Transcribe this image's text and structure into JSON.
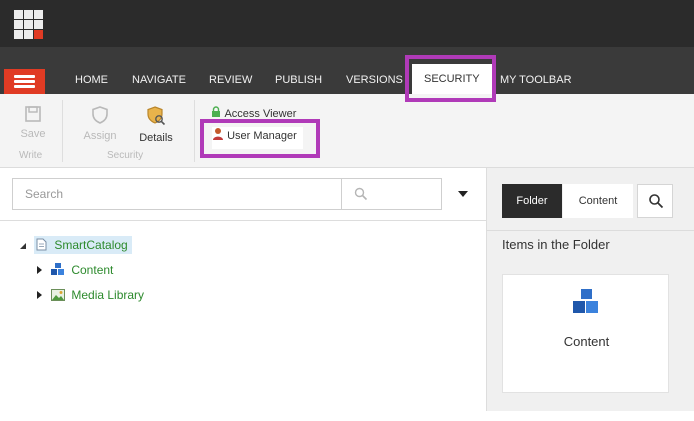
{
  "ribbon": {
    "tabs": [
      "HOME",
      "NAVIGATE",
      "REVIEW",
      "PUBLISH",
      "VERSIONS",
      "SECURITY",
      "MY TOOLBAR"
    ],
    "active_tab": "SECURITY"
  },
  "toolbar": {
    "save_label": "Save",
    "write_group": "Write",
    "assign_label": "Assign",
    "details_label": "Details",
    "security_group": "Security",
    "access_viewer_label": "Access Viewer",
    "user_manager_label": "User Manager"
  },
  "search": {
    "placeholder": "Search"
  },
  "tree": {
    "root": "SmartCatalog",
    "children": [
      "Content",
      "Media Library"
    ]
  },
  "right_panel": {
    "tabs": [
      "Folder",
      "Content"
    ],
    "active_tab": "Folder",
    "heading": "Items in the Folder",
    "items": [
      {
        "label": "Content"
      }
    ]
  },
  "colors": {
    "accent_red": "#e03b24",
    "highlight": "#b03ab8",
    "tree_text": "#2d8a2d"
  },
  "icons": {
    "app": "app-grid-icon",
    "menu": "hamburger-icon",
    "save": "floppy-disk-icon",
    "assign": "shield-icon",
    "details": "shield-details-icon",
    "access_viewer": "lock-icon",
    "user_manager": "user-icon",
    "search": "magnifier-icon",
    "dropdown": "caret-down-icon",
    "content": "cubes-icon",
    "media": "image-icon",
    "page": "page-icon"
  }
}
